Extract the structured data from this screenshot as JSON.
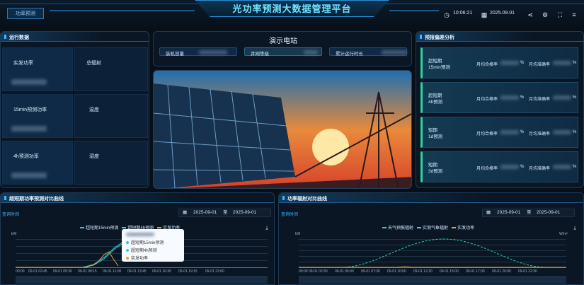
{
  "header": {
    "menu_label": "功率预测",
    "title": "光功率预测大数据管理平台",
    "time": "10:06:21",
    "date": "2025.09.01",
    "icons": [
      "clock-icon",
      "calendar-icon",
      "share-icon",
      "settings-icon",
      "fullscreen-icon",
      "menu-icon"
    ]
  },
  "run_data": {
    "title": "运行数据",
    "items": [
      {
        "label": "实发功率"
      },
      {
        "label": "总辐射"
      },
      {
        "label": "15min预测功率"
      },
      {
        "label": "温度"
      },
      {
        "label": "4h预测功率"
      },
      {
        "label": "湿度"
      }
    ]
  },
  "station": {
    "title": "演示电站",
    "stats": [
      {
        "label": "装机容量"
      },
      {
        "label": "并网等级"
      },
      {
        "label": "累计运行时长"
      }
    ]
  },
  "forecast": {
    "title": "预报偏差分析",
    "qual_label": "月均合格率",
    "acc_label": "月均准确率",
    "unit": "%",
    "cards": [
      {
        "name": "超短期\n15min预测"
      },
      {
        "name": "超短期\n4h预测"
      },
      {
        "name": "短期\n1d预测"
      },
      {
        "name": "短期\n3d预测"
      }
    ]
  },
  "chart1": {
    "title": "超短期功率预测对比曲线",
    "query_label": "查询时间",
    "date_from": "2025-09-01",
    "sep": "至",
    "date_to": "2025-09-01",
    "yunit": "kW",
    "legend": [
      "超短期15min预测",
      "超短期4h预测",
      "实发功率"
    ],
    "xticks": [
      "00:00",
      "09-01 02:45",
      "09-01 05:30",
      "09-01 08:15",
      "09-01 11:00",
      "09-01 13:45",
      "09-01 16:30",
      "09-01 19:15",
      "09-01 22:00"
    ],
    "tooltip": [
      "超短期15min预测",
      "超短期4h预测",
      "实发功率"
    ]
  },
  "chart2": {
    "title": "功率辐射对比曲线",
    "query_label": "查询时间",
    "date_from": "2025-09-01",
    "sep": "至",
    "date_to": "2025-09-01",
    "yunit_left": "kW",
    "yunit_right": "W/m²",
    "legend": [
      "天气预报辐射",
      "实测气象辐射",
      "实发功率"
    ],
    "xticks": [
      "00:00",
      "09-01 02:30",
      "09-01 05:00",
      "09-01 07:30",
      "09-01 10:00",
      "09-01 12:30",
      "09-01 15:00",
      "09-01 17:30",
      "09-01 20:00",
      "09-01 22:30"
    ]
  },
  "colors": {
    "accent": "#3fb6ff",
    "green": "#2fd3a1",
    "orange": "#e2a03f",
    "title": "#6fe3ff"
  }
}
